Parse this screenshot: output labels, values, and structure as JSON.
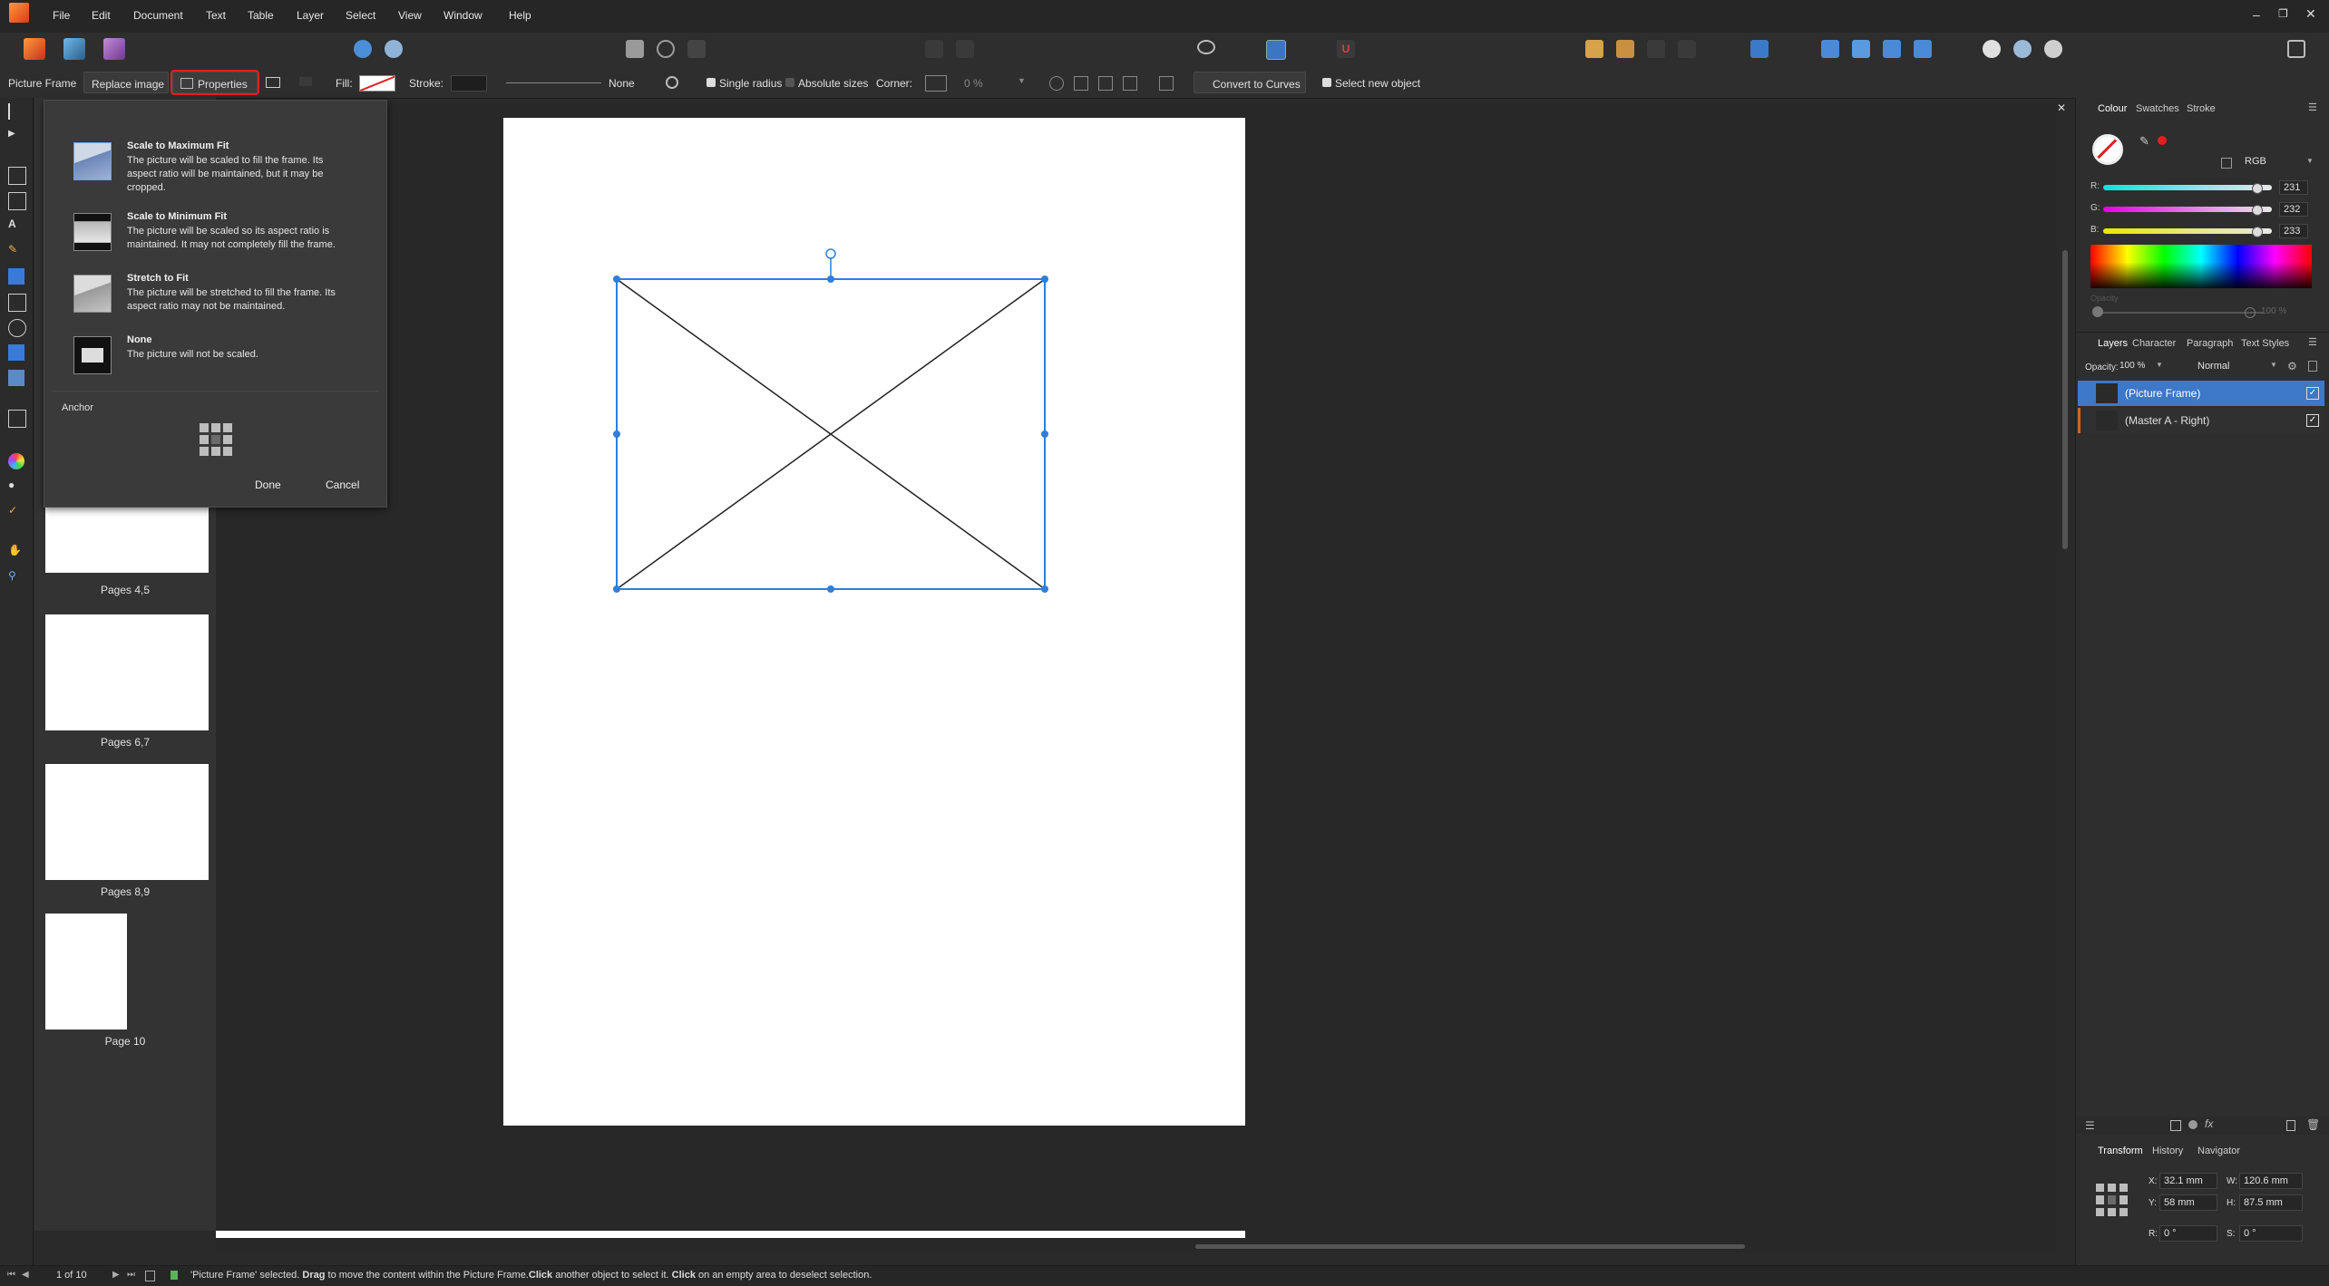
{
  "app": {
    "menu": [
      "File",
      "Edit",
      "Document",
      "Text",
      "Table",
      "Layer",
      "Select",
      "View",
      "Window",
      "Help"
    ]
  },
  "context_toolbar": {
    "tool_name": "Picture Frame",
    "replace_image": "Replace image",
    "properties": "Properties",
    "fill_label": "Fill:",
    "stroke_label": "Stroke:",
    "stroke_none": "None",
    "single_radius": "Single radius",
    "absolute_sizes": "Absolute sizes",
    "corner_label": "Corner:",
    "corner_value": "0 %",
    "convert_to_curves": "Convert to Curves",
    "select_new_object": "Select new object"
  },
  "properties_popover": {
    "options": [
      {
        "title": "Scale to Maximum Fit",
        "desc": "The picture will be scaled to fill the frame. Its aspect ratio will be maintained, but it may be cropped."
      },
      {
        "title": "Scale to Minimum Fit",
        "desc": "The picture will be scaled so its aspect ratio is maintained. It may not completely fill the frame."
      },
      {
        "title": "Stretch to Fit",
        "desc": "The picture will be stretched to fill the frame. Its aspect ratio may not be maintained."
      },
      {
        "title": "None",
        "desc": "The picture will not be scaled."
      }
    ],
    "anchor_label": "Anchor",
    "done": "Done",
    "cancel": "Cancel"
  },
  "pages_panel": {
    "labels": [
      "Pages 4,5",
      "Pages 6,7",
      "Pages 8,9",
      "Page 10"
    ]
  },
  "colour_panel": {
    "tabs": [
      "Colour",
      "Swatches",
      "Stroke"
    ],
    "model": "RGB",
    "r_label": "R:",
    "g_label": "G:",
    "b_label": "B:",
    "r": "231",
    "g": "232",
    "b": "233",
    "opacity_label": "Opacity",
    "opacity_value": "100 %"
  },
  "layers_panel": {
    "tabs": [
      "Layers",
      "Character",
      "Paragraph",
      "Text Styles"
    ],
    "opacity_label": "Opacity:",
    "opacity_value": "100 %",
    "blend_mode": "Normal",
    "layers": [
      "(Picture Frame)",
      "(Master A - Right)"
    ]
  },
  "transform_panel": {
    "tabs": [
      "Transform",
      "History",
      "Navigator"
    ],
    "x_label": "X:",
    "x": "32.1 mm",
    "y_label": "Y:",
    "y": "58 mm",
    "w_label": "W:",
    "w": "120.6 mm",
    "h_label": "H:",
    "h": "87.5 mm",
    "r_label": "R:",
    "r": "0 °",
    "s_label": "S:",
    "s": "0 °"
  },
  "status": {
    "page_counter": "1 of 10",
    "message_parts": {
      "a": "'Picture Frame' selected. ",
      "b": "Drag",
      "c": " to move the content within the Picture Frame.",
      "d": "Click",
      "e": " another object to select it. ",
      "f": "Click",
      "g": " on an empty area to deselect selection."
    }
  },
  "colors": {
    "accent": "#4a90e2",
    "highlight_box": "#e02020",
    "selection": "#2f7fd8"
  }
}
